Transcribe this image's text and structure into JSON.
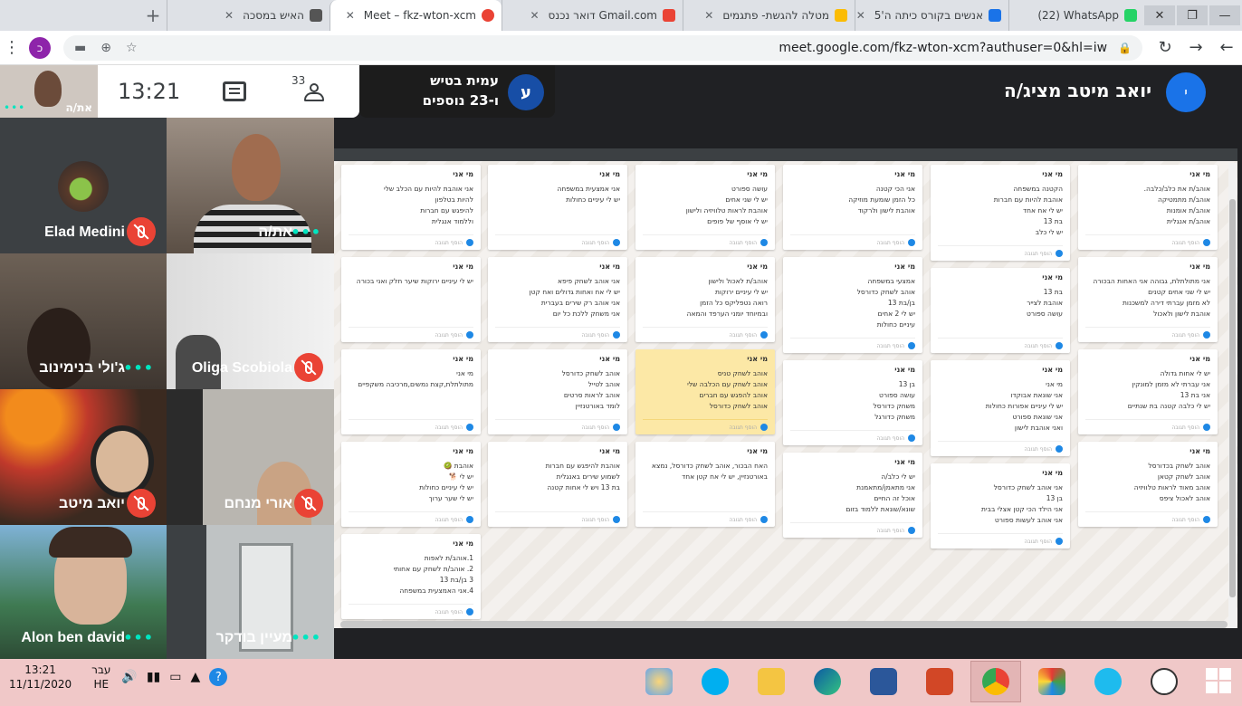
{
  "browser": {
    "tabs": [
      {
        "label": "(22) WhatsApp",
        "badge": "22",
        "color": "#25d366"
      },
      {
        "label": "אנשים בקורס כיתה ה'5",
        "color": "#1a73e8"
      },
      {
        "label": "מטלה להגשת- פתגמים",
        "color": "#fbbc04"
      },
      {
        "label": "דואר נכנס Gmail.com",
        "color": "#ea4335"
      },
      {
        "label": "Meet – fkz-wton-xcm",
        "color": "#ea4335",
        "active": true
      },
      {
        "label": "האיש במסכה",
        "color": "#555555"
      }
    ],
    "new_tab": "+",
    "url": "meet.google.com/fkz-wton-xcm?authuser=0&hl=iw",
    "profile_letter": "כ",
    "win_buttons": [
      "✕",
      "❐",
      "—"
    ]
  },
  "meet": {
    "time": "13:21",
    "participants_count": "33",
    "self_label": "את/ה",
    "presenter": {
      "avatar": "י",
      "label": "יואב מיטב מציג/ה"
    },
    "speaker": {
      "avatar": "ע",
      "name": "עמית בטיש",
      "more": "ו-23 נוספים"
    },
    "tiles": [
      {
        "name": "את/ה"
      },
      {
        "name": "Elad Medini"
      },
      {
        "name": "Oliga Scobiola"
      },
      {
        "name": "ג'ולי בנימינוב"
      },
      {
        "name": "אורי מנחם"
      },
      {
        "name": "יואב מיטב"
      },
      {
        "name": "מעיין בודקר"
      },
      {
        "name": "Alon ben david"
      }
    ]
  },
  "board": {
    "card_title": "מי אני",
    "add_comment": "הוסף תגובה",
    "columns": [
      [
        "אוהב/ת את כלב/כלבה.\nאוהב/ת מתמטיקה\nאוהב/ת אומנות\nאוהב/ת אנגלית",
        "אני מתולתלת, גבוהה אני האחות הבכורה\nיש לי שני אחים קטנים\nלא מזמן עברתי דירה למשכנות\nאוהבת לישון ולאכול",
        "יש לי אחות גדולה\nאני עברתי לא מזמן למונקין\nאני בת 13\nיש לי כלבה קטנה בת שנתיים",
        "אוהב לשחק בכדורסל\nאוהב לשחק קטאן\nאוהב מאוד לראות טלוויזיה\nאוהב לאכול ציפס"
      ],
      [
        "הקטנה במשפחה\nאוהבת להיות עם חברות\nיש לי אח אחד\nבת 13\nיש לי כלב",
        "בת 13\nאוהבת לצייר\nעושה ספורט",
        "מי אני\nאני שונאת אבוקדו\nיש לי עיניים אפורות כחולות\nאני שונאת ספורט\nואני אוהבת לישון",
        "אני אוהב לשחק כדורסל\nבן 13\nאני הילד הכי קטן אצלי בבית\nאני אוהב לעשות ספורט"
      ],
      [
        "אני הכי קטנה\nכל הזמן שומעת מוזיקה\nאוהבת לישון ולרקוד",
        "אמצעי במשפחה\nאוהב לשחק כדורסל\nבן/בת 13\nיש לי 2 אחים\nעיניים כחולות",
        "בן 13\nעושה ספורט\nמשחק כדורסל\nמשחק כדורגל",
        "יש לי כלב/ה\nאני מתאמן/מתאמנת\nאוכל זה החיים\nשונא/שונאת ללמוד בזום"
      ],
      [
        "עושה ספורט\nיש לי שני אחים\nאוהבת לראות טלוויזיה ולישון\nיש לי אוסף של פופים",
        "אוהב/ת לאכול ולישון\nיש לי עיניים ירוקות\nרואה נטפליקס כל הזמן\nובמיוחד יומני הערפד והמאה",
        "אוהב לשחק טניס\nאוהב לשחק עם הכלבה שלי\nאוהב להפגש עם חברים\nאוהב לשחק כדורסל",
        "האח הבכור, אוהב לשחק כדורסל, נמצא באורטנזיין, יש לי אח קטן אחד"
      ],
      [
        "אני אמצעית במשפחה\nיש לי עיניים כחולות",
        "אני אוהב לשחק פיפא\nיש לי אח ואחות גדולים ואח קטן\nאני אוהב רק שירים בעברית\nאני משחק ללכת כל יום",
        "אוהב לשחק כדורסל\nאוהב לטייל\nאוהב לראות סרטים\nלומד באורטנזיין",
        "אוהבת להיפגש עם חברות\nלשמוע שירים באנגלית\nבת 13 ויש לי אחות קטנה"
      ],
      [
        "אני אוהבת להיות עם הכלב שלי\nלהיות בטלפון\nלהיפגש עם חברות\nוללמוד אנגלית",
        "יש לי עיניים ירוקות שיער חלק ואני בכורה",
        "מי אני\nמתולתלת,קצת נמשים,מרכיבה משקפיים",
        "אוהבת 🥝\nיש לי 🐕\nיש לי עיניים כחולות\nיש לי שער ערוך",
        "1.אוהב/ת לאפות\n2. אוהב/ת לשחק עם אחותי\n3 בן/בת 13\n4.אני האמצעית במשפחה"
      ]
    ]
  },
  "taskbar": {
    "time": "13:21",
    "date": "11/11/2020",
    "lang_top": "עבר",
    "lang_bottom": "HE",
    "help": "?"
  },
  "colors": {
    "accent": "#1a73e8",
    "mic_off": "#ea4335",
    "dots": "#00e5c0",
    "highlight_card": "#fce8a6"
  }
}
